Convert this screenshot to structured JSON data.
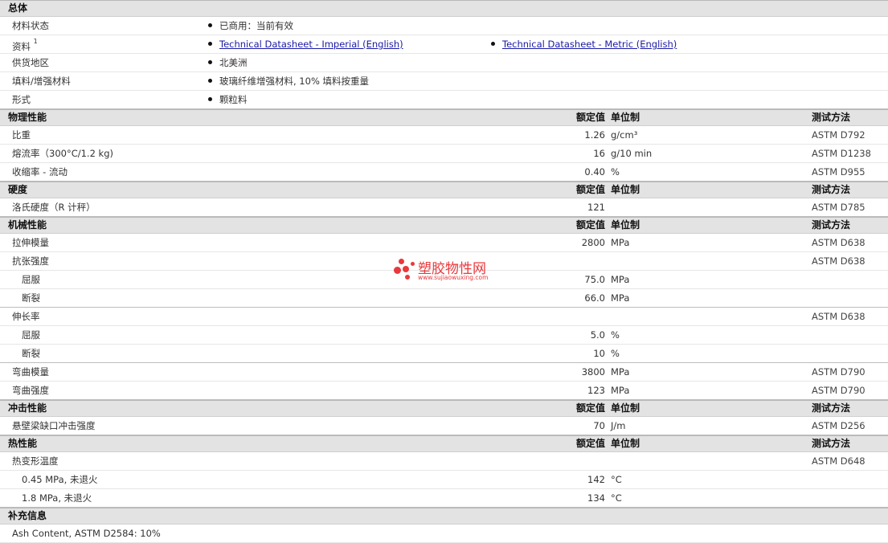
{
  "general": {
    "title": "总体",
    "rows": [
      {
        "label": "材料状态",
        "items": [
          "已商用：当前有效"
        ]
      },
      {
        "label": "资料",
        "sup": "1",
        "links": [
          "Technical Datasheet - Imperial (English)",
          "Technical Datasheet - Metric (English)"
        ]
      },
      {
        "label": "供货地区",
        "items": [
          "北美洲"
        ]
      },
      {
        "label": "填料/增强材料",
        "items": [
          "玻璃纤维增强材料, 10% 填料按重量"
        ]
      },
      {
        "label": "形式",
        "items": [
          "颗粒料"
        ]
      }
    ]
  },
  "headers": {
    "value": "额定值",
    "unit": "单位制",
    "test": "测试方法"
  },
  "physical": {
    "title": "物理性能",
    "rows": [
      {
        "label": "比重",
        "value": "1.26",
        "unit": "g/cm³",
        "test": "ASTM D792"
      },
      {
        "label": "熔流率（300°C/1.2 kg)",
        "value": "16",
        "unit": "g/10 min",
        "test": "ASTM D1238"
      },
      {
        "label": "收缩率 - 流动",
        "value": "0.40",
        "unit": "%",
        "test": "ASTM D955"
      }
    ]
  },
  "hardness": {
    "title": "硬度",
    "rows": [
      {
        "label": "洛氏硬度（R 计秤）",
        "value": "121",
        "unit": "",
        "test": "ASTM D785"
      }
    ]
  },
  "mechanical": {
    "title": "机械性能",
    "rows": [
      {
        "label": "拉伸模量",
        "value": "2800",
        "unit": "MPa",
        "test": "ASTM D638"
      },
      {
        "label": "抗张强度",
        "value": "",
        "unit": "",
        "test": "ASTM D638"
      },
      {
        "label": "屈服",
        "value": "75.0",
        "unit": "MPa",
        "test": "",
        "sub": true
      },
      {
        "label": "断裂",
        "value": "66.0",
        "unit": "MPa",
        "test": "",
        "sub": true,
        "last": true
      },
      {
        "label": "伸长率",
        "value": "",
        "unit": "",
        "test": "ASTM D638"
      },
      {
        "label": "屈服",
        "value": "5.0",
        "unit": "%",
        "test": "",
        "sub": true
      },
      {
        "label": "断裂",
        "value": "10",
        "unit": "%",
        "test": "",
        "sub": true,
        "last": true
      },
      {
        "label": "弯曲模量",
        "value": "3800",
        "unit": "MPa",
        "test": "ASTM D790"
      },
      {
        "label": "弯曲强度",
        "value": "123",
        "unit": "MPa",
        "test": "ASTM D790"
      }
    ]
  },
  "impact": {
    "title": "冲击性能",
    "rows": [
      {
        "label": "悬壁梁缺口冲击强度",
        "value": "70",
        "unit": "J/m",
        "test": "ASTM D256"
      }
    ]
  },
  "thermal": {
    "title": "热性能",
    "rows": [
      {
        "label": "热变形温度",
        "value": "",
        "unit": "",
        "test": "ASTM D648"
      },
      {
        "label": "0.45 MPa, 未退火",
        "value": "142",
        "unit": "°C",
        "test": "",
        "sub": true
      },
      {
        "label": "1.8 MPa, 未退火",
        "value": "134",
        "unit": "°C",
        "test": "",
        "sub": true
      }
    ]
  },
  "supplemental": {
    "title": "补充信息",
    "text": "Ash Content, ASTM D2584: 10%"
  },
  "watermark": {
    "cn": "塑胶物性网",
    "url": "www.sujiaowuxing.com"
  }
}
